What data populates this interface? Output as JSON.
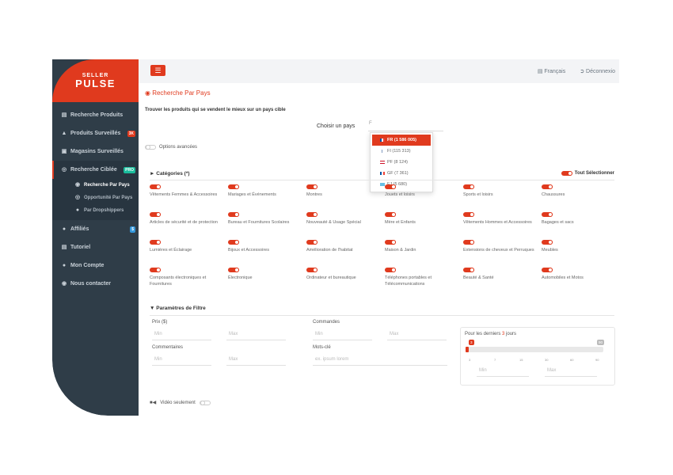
{
  "brand": {
    "line1": "SELLER",
    "line2": "PULSE"
  },
  "sidebar": {
    "items": [
      {
        "label": "Recherche Produits",
        "icon": "database-icon"
      },
      {
        "label": "Produits Surveillés",
        "icon": "bell-icon",
        "badge": "3K"
      },
      {
        "label": "Magasins Surveillés",
        "icon": "store-icon"
      },
      {
        "label": "Recherche Ciblée",
        "icon": "target-icon",
        "badge": "PRO"
      },
      {
        "label": "Affiliés",
        "icon": "users-icon",
        "badge": "$"
      },
      {
        "label": "Tutoriel",
        "icon": "book-icon"
      },
      {
        "label": "Mon Compte",
        "icon": "user-icon"
      },
      {
        "label": "Nous contacter",
        "icon": "globe-icon"
      }
    ],
    "subitems": [
      {
        "label": "Recherche Par Pays",
        "icon": "globe-icon"
      },
      {
        "label": "Opportunité Par Pays",
        "icon": "target-icon"
      },
      {
        "label": "Par Dropshippers",
        "icon": "user-icon"
      }
    ]
  },
  "topbar": {
    "language": "Français",
    "logout": "Déconnexio"
  },
  "page": {
    "title": "Recherche Par Pays",
    "subtitle": "Trouver les produits qui se vendent le mieux sur un pays cible",
    "country_label": "Choisir un pays",
    "country_value": "F",
    "advanced_label": "Options avancées"
  },
  "dropdown": [
    {
      "label": "FR (1 586 005)",
      "flag": [
        "#0055a4",
        "#ffffff",
        "#ef4135"
      ]
    },
    {
      "label": "FI (115 313)",
      "flag": [
        "#ffffff",
        "#003580",
        "#ffffff"
      ]
    },
    {
      "label": "PF (8 124)",
      "flag": [
        "#ce1126",
        "#ffffff",
        "#ce1126"
      ]
    },
    {
      "label": "GF (7 361)",
      "flag": [
        "#0055a4",
        "#ffffff",
        "#ef4135"
      ]
    },
    {
      "label": "FJ (5 680)",
      "flag": [
        "#68bfe5",
        "#68bfe5",
        "#68bfe5"
      ]
    }
  ],
  "categories": {
    "title": "Catégories (*)",
    "select_all": "Tout Sélectionner",
    "items": [
      "Vêtements Femmes & Accessoires",
      "Mariages et Événements",
      "Montres",
      "Jouets et loisirs",
      "Sports et loisirs",
      "Chaussures",
      "Articles de sécurité et de protection",
      "Bureau et Fournitures Scolaires",
      "Nouveauté & Usage Spécial",
      "Mère et Enfants",
      "Vêtements Hommes et Accessoires",
      "Bagages et sacs",
      "Lumières et Éclairage",
      "Bijoux et Accessoires",
      "Amélioration de l'habitat",
      "Maison & Jardin",
      "Extensions de cheveux et Perruques",
      "Meubles",
      "Composants électroniques et Fournitures",
      "Électronique",
      "Ordinateur et bureautique",
      "Téléphones portables et Télécommunications",
      "Beauté & Santé",
      "Automobiles et Motos"
    ]
  },
  "filters": {
    "title": "Paramètres de Filtre",
    "prix_label": "Prix ($)",
    "commandes_label": "Commandes",
    "commentaires_label": "Commentaires",
    "motscle_label": "Mots-clé",
    "min_ph": "Min",
    "max_ph": "Max",
    "keyword_ph": "ex. ipsum lorem",
    "days_prefix": "Pour les derniers",
    "days_value": "3",
    "days_suffix": "jours",
    "slider_min": "3",
    "slider_max": "90",
    "ticks": [
      "3",
      "7",
      "15",
      "30",
      "60",
      "90"
    ],
    "video_label": "Vidéo seulement"
  },
  "colors": {
    "accent": "#e03a1e",
    "sidebar": "#2f3d48"
  }
}
